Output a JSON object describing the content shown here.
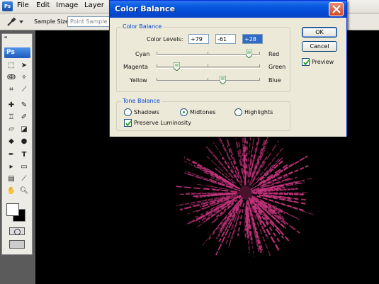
{
  "app": {
    "logo_text": "Ps",
    "menu": [
      "File",
      "Edit",
      "Image",
      "Layer"
    ]
  },
  "options_bar": {
    "sample_size_label": "Sample Size:",
    "sample_size_value": "Point Sample"
  },
  "toolbox": {
    "logo_text": "Ps",
    "tools": [
      "marquee-icon",
      "move-icon",
      "lasso-icon",
      "magic-wand-icon",
      "crop-icon",
      "slice-icon",
      "healing-brush-icon",
      "brush-icon",
      "clone-stamp-icon",
      "history-brush-icon",
      "eraser-icon",
      "paint-bucket-icon",
      "blur-icon",
      "dodge-icon",
      "pen-icon",
      "type-icon",
      "path-selection-icon",
      "shape-icon",
      "notes-icon",
      "eyedropper-icon",
      "hand-icon",
      "zoom-icon"
    ],
    "foreground_color": "#ffffff",
    "background_color": "#000000"
  },
  "dialog": {
    "title": "Color Balance",
    "color_balance_group": "Color Balance",
    "color_levels_label": "Color Levels:",
    "levels": [
      "+79",
      "-61",
      "+28"
    ],
    "sliders": [
      {
        "left": "Cyan",
        "right": "Red",
        "value": 79
      },
      {
        "left": "Magenta",
        "right": "Green",
        "value": -61
      },
      {
        "left": "Yellow",
        "right": "Blue",
        "value": 28
      }
    ],
    "tone_balance_group": "Tone Balance",
    "tones": [
      {
        "label": "Shadows",
        "selected": false
      },
      {
        "label": "Midtones",
        "selected": true
      },
      {
        "label": "Highlights",
        "selected": false
      }
    ],
    "preserve_luminosity": {
      "label": "Preserve Luminosity",
      "checked": true
    },
    "ok_label": "OK",
    "cancel_label": "Cancel",
    "preview": {
      "label": "Preview",
      "checked": true
    }
  },
  "canvas": {
    "firework_color": "#c8357f"
  }
}
